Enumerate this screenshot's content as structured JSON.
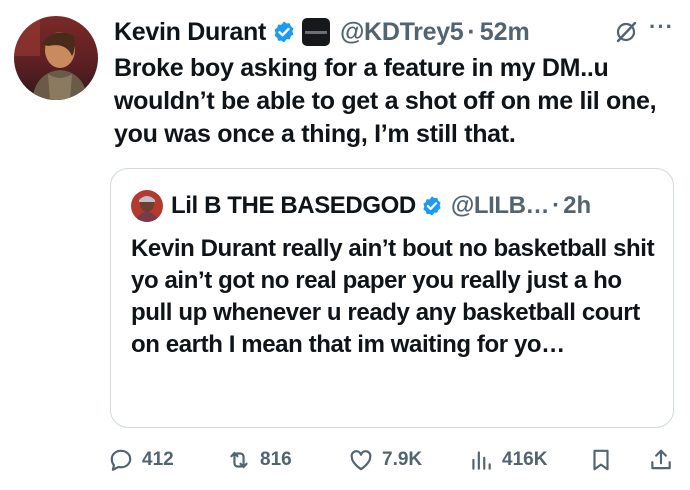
{
  "tweet": {
    "author_name": "Kevin Durant",
    "handle": "@KDTrey5",
    "separator": "·",
    "time": "52m",
    "more": "···",
    "text": "Broke boy asking for a feature in my DM..u wouldn’t be able to get a shot off on me lil one, you was once a thing, I’m still that."
  },
  "quoted": {
    "author_name": "Lil B THE BASEDGOD",
    "handle": "@LILB…",
    "separator": "·",
    "time": "2h",
    "text": "Kevin Durant really ain’t bout no basketball shit yo ain’t got no real paper you really just a ho pull up whenever u ready any basketball court on earth I mean that im waiting for yo…"
  },
  "actions": {
    "replies": "412",
    "reposts": "816",
    "likes": "7.9K",
    "views": "416K"
  },
  "colors": {
    "verified": "#1d9bf0",
    "muted": "#536471",
    "border": "#cfd9de",
    "text": "#0f1419"
  },
  "icons": [
    "verified-badge-icon",
    "affiliate-badge-icon",
    "grok-icon",
    "more-icon",
    "reply-icon",
    "repost-icon",
    "like-icon",
    "views-icon",
    "bookmark-icon",
    "share-icon"
  ]
}
